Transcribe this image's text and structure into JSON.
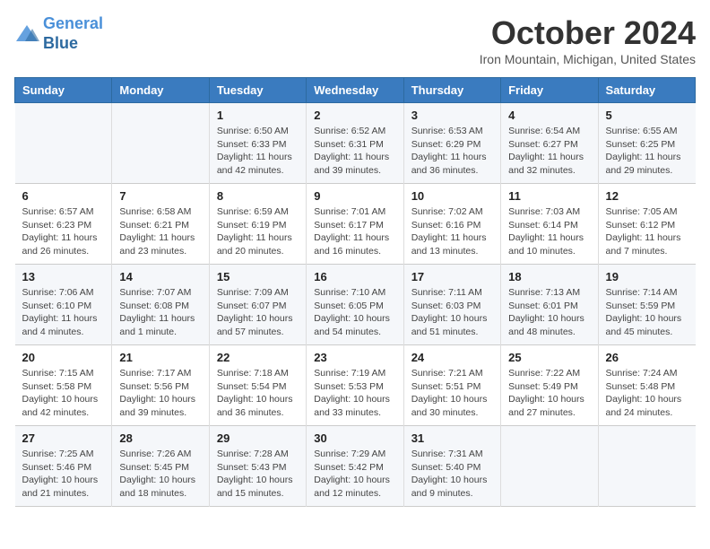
{
  "header": {
    "logo_line1": "General",
    "logo_line2": "Blue",
    "month_title": "October 2024",
    "location": "Iron Mountain, Michigan, United States"
  },
  "weekdays": [
    "Sunday",
    "Monday",
    "Tuesday",
    "Wednesday",
    "Thursday",
    "Friday",
    "Saturday"
  ],
  "weeks": [
    [
      {
        "day": "",
        "info": ""
      },
      {
        "day": "",
        "info": ""
      },
      {
        "day": "1",
        "info": "Sunrise: 6:50 AM\nSunset: 6:33 PM\nDaylight: 11 hours and 42 minutes."
      },
      {
        "day": "2",
        "info": "Sunrise: 6:52 AM\nSunset: 6:31 PM\nDaylight: 11 hours and 39 minutes."
      },
      {
        "day": "3",
        "info": "Sunrise: 6:53 AM\nSunset: 6:29 PM\nDaylight: 11 hours and 36 minutes."
      },
      {
        "day": "4",
        "info": "Sunrise: 6:54 AM\nSunset: 6:27 PM\nDaylight: 11 hours and 32 minutes."
      },
      {
        "day": "5",
        "info": "Sunrise: 6:55 AM\nSunset: 6:25 PM\nDaylight: 11 hours and 29 minutes."
      }
    ],
    [
      {
        "day": "6",
        "info": "Sunrise: 6:57 AM\nSunset: 6:23 PM\nDaylight: 11 hours and 26 minutes."
      },
      {
        "day": "7",
        "info": "Sunrise: 6:58 AM\nSunset: 6:21 PM\nDaylight: 11 hours and 23 minutes."
      },
      {
        "day": "8",
        "info": "Sunrise: 6:59 AM\nSunset: 6:19 PM\nDaylight: 11 hours and 20 minutes."
      },
      {
        "day": "9",
        "info": "Sunrise: 7:01 AM\nSunset: 6:17 PM\nDaylight: 11 hours and 16 minutes."
      },
      {
        "day": "10",
        "info": "Sunrise: 7:02 AM\nSunset: 6:16 PM\nDaylight: 11 hours and 13 minutes."
      },
      {
        "day": "11",
        "info": "Sunrise: 7:03 AM\nSunset: 6:14 PM\nDaylight: 11 hours and 10 minutes."
      },
      {
        "day": "12",
        "info": "Sunrise: 7:05 AM\nSunset: 6:12 PM\nDaylight: 11 hours and 7 minutes."
      }
    ],
    [
      {
        "day": "13",
        "info": "Sunrise: 7:06 AM\nSunset: 6:10 PM\nDaylight: 11 hours and 4 minutes."
      },
      {
        "day": "14",
        "info": "Sunrise: 7:07 AM\nSunset: 6:08 PM\nDaylight: 11 hours and 1 minute."
      },
      {
        "day": "15",
        "info": "Sunrise: 7:09 AM\nSunset: 6:07 PM\nDaylight: 10 hours and 57 minutes."
      },
      {
        "day": "16",
        "info": "Sunrise: 7:10 AM\nSunset: 6:05 PM\nDaylight: 10 hours and 54 minutes."
      },
      {
        "day": "17",
        "info": "Sunrise: 7:11 AM\nSunset: 6:03 PM\nDaylight: 10 hours and 51 minutes."
      },
      {
        "day": "18",
        "info": "Sunrise: 7:13 AM\nSunset: 6:01 PM\nDaylight: 10 hours and 48 minutes."
      },
      {
        "day": "19",
        "info": "Sunrise: 7:14 AM\nSunset: 5:59 PM\nDaylight: 10 hours and 45 minutes."
      }
    ],
    [
      {
        "day": "20",
        "info": "Sunrise: 7:15 AM\nSunset: 5:58 PM\nDaylight: 10 hours and 42 minutes."
      },
      {
        "day": "21",
        "info": "Sunrise: 7:17 AM\nSunset: 5:56 PM\nDaylight: 10 hours and 39 minutes."
      },
      {
        "day": "22",
        "info": "Sunrise: 7:18 AM\nSunset: 5:54 PM\nDaylight: 10 hours and 36 minutes."
      },
      {
        "day": "23",
        "info": "Sunrise: 7:19 AM\nSunset: 5:53 PM\nDaylight: 10 hours and 33 minutes."
      },
      {
        "day": "24",
        "info": "Sunrise: 7:21 AM\nSunset: 5:51 PM\nDaylight: 10 hours and 30 minutes."
      },
      {
        "day": "25",
        "info": "Sunrise: 7:22 AM\nSunset: 5:49 PM\nDaylight: 10 hours and 27 minutes."
      },
      {
        "day": "26",
        "info": "Sunrise: 7:24 AM\nSunset: 5:48 PM\nDaylight: 10 hours and 24 minutes."
      }
    ],
    [
      {
        "day": "27",
        "info": "Sunrise: 7:25 AM\nSunset: 5:46 PM\nDaylight: 10 hours and 21 minutes."
      },
      {
        "day": "28",
        "info": "Sunrise: 7:26 AM\nSunset: 5:45 PM\nDaylight: 10 hours and 18 minutes."
      },
      {
        "day": "29",
        "info": "Sunrise: 7:28 AM\nSunset: 5:43 PM\nDaylight: 10 hours and 15 minutes."
      },
      {
        "day": "30",
        "info": "Sunrise: 7:29 AM\nSunset: 5:42 PM\nDaylight: 10 hours and 12 minutes."
      },
      {
        "day": "31",
        "info": "Sunrise: 7:31 AM\nSunset: 5:40 PM\nDaylight: 10 hours and 9 minutes."
      },
      {
        "day": "",
        "info": ""
      },
      {
        "day": "",
        "info": ""
      }
    ]
  ]
}
